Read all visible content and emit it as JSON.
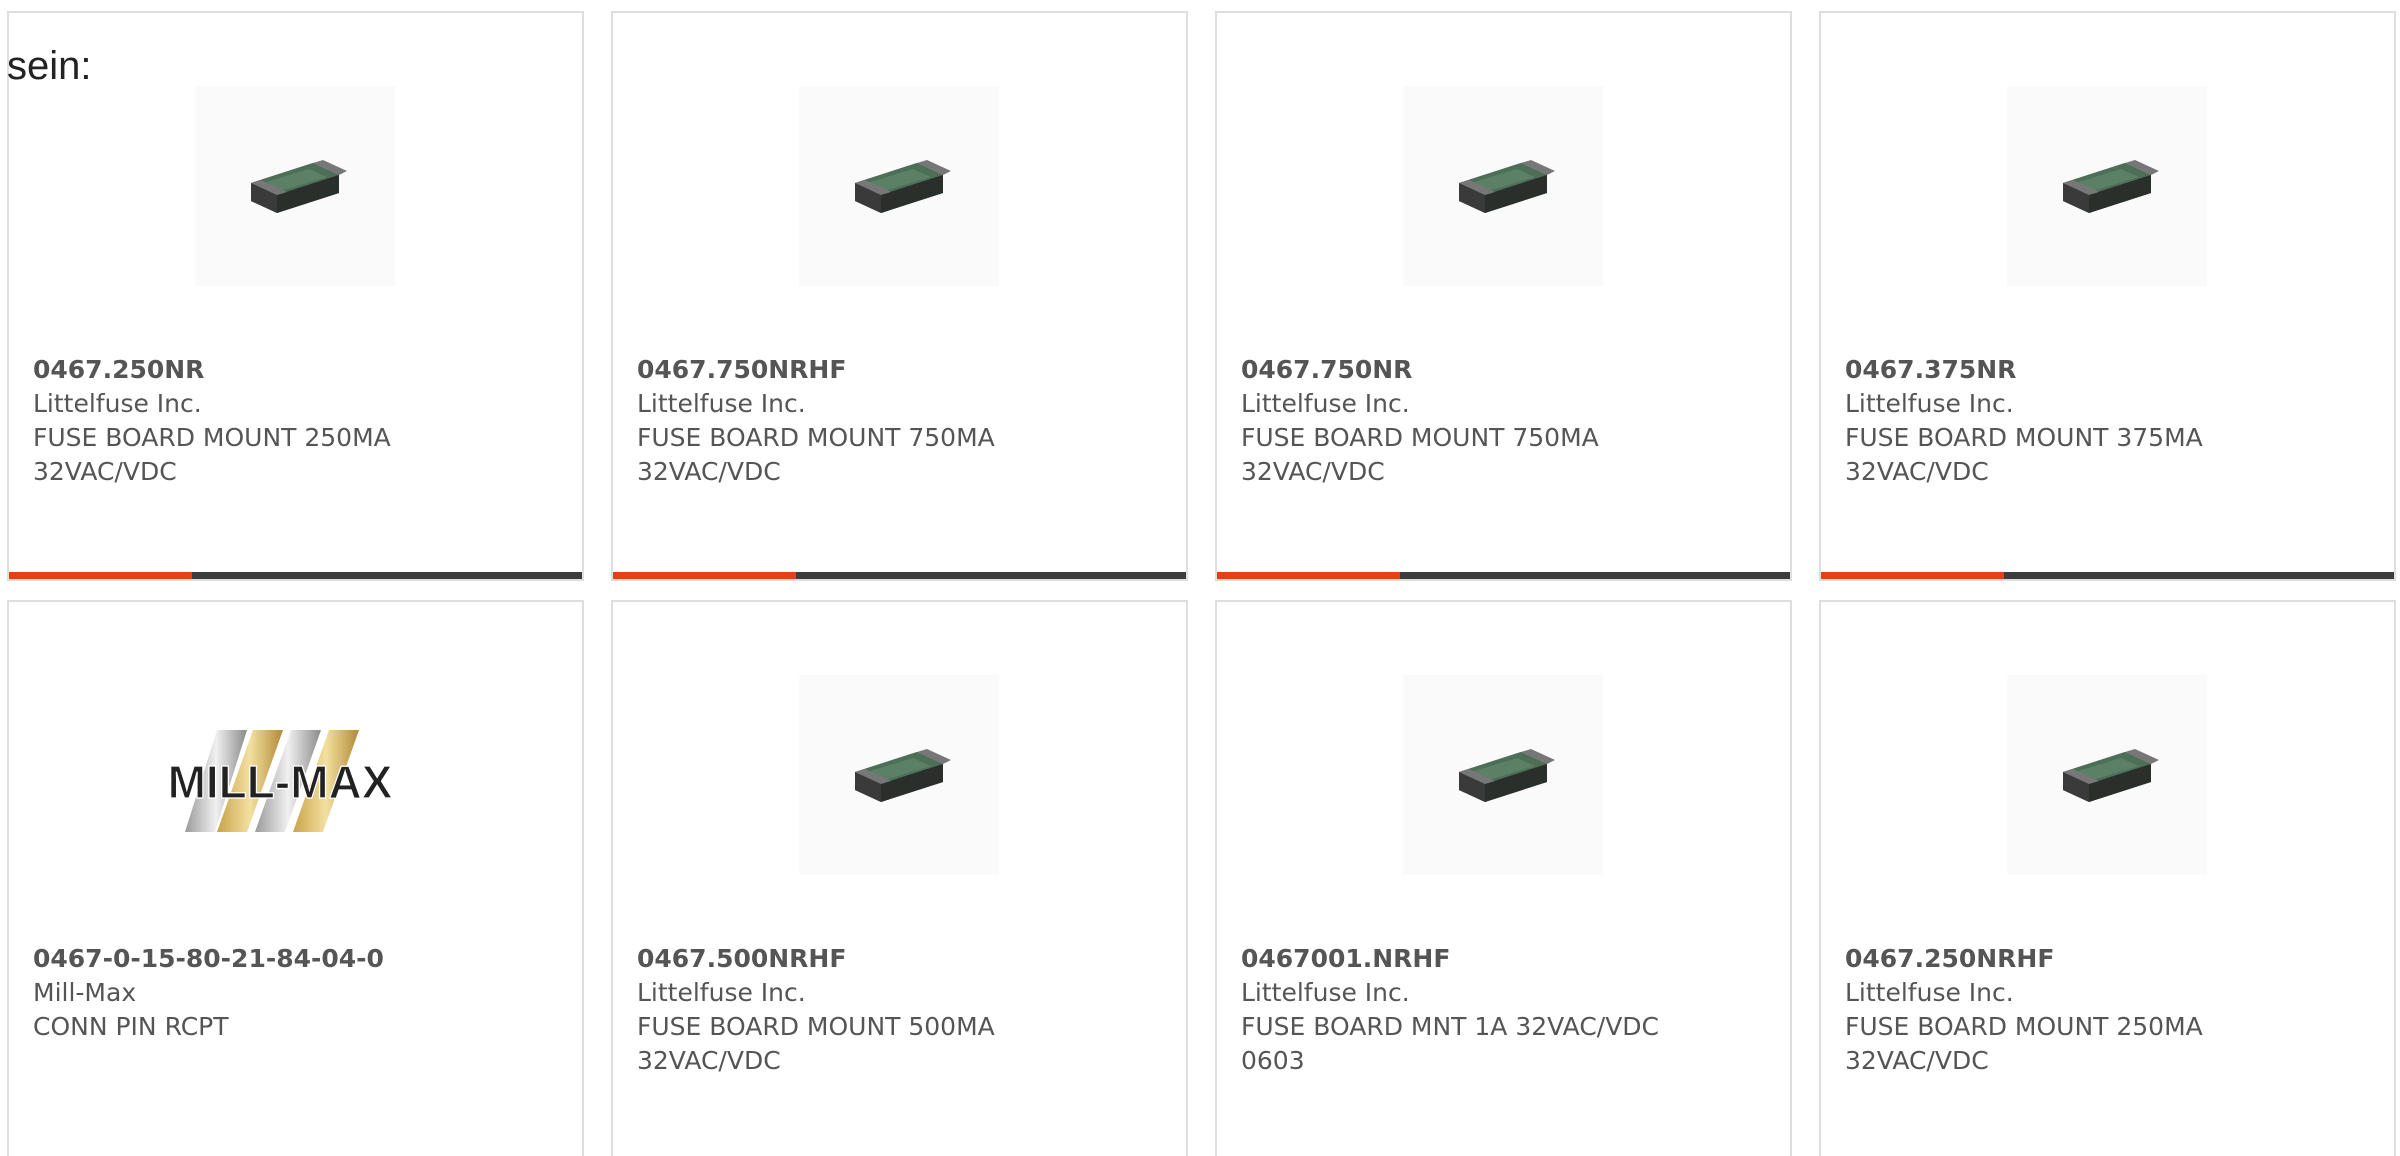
{
  "intro_text": "sein:",
  "accent_color": "#e83e1a",
  "bar_color": "#3c3c3c",
  "products": [
    {
      "part_number": "0467.250NR",
      "manufacturer": "Littelfuse Inc.",
      "description": "FUSE BOARD MOUNT 250MA 32VAC/VDC",
      "image": "fuse-chip-icon",
      "progress_fraction": 0.32
    },
    {
      "part_number": "0467.750NRHF",
      "manufacturer": "Littelfuse Inc.",
      "description": "FUSE BOARD MOUNT 750MA 32VAC/VDC",
      "image": "fuse-chip-icon",
      "progress_fraction": 0.32
    },
    {
      "part_number": "0467.750NR",
      "manufacturer": "Littelfuse Inc.",
      "description": "FUSE BOARD MOUNT 750MA 32VAC/VDC",
      "image": "fuse-chip-icon",
      "progress_fraction": 0.32
    },
    {
      "part_number": "0467.375NR",
      "manufacturer": "Littelfuse Inc.",
      "description": "FUSE BOARD MOUNT 375MA 32VAC/VDC",
      "image": "fuse-chip-icon",
      "progress_fraction": 0.32
    },
    {
      "part_number": "0467-0-15-80-21-84-04-0",
      "manufacturer": "Mill-Max",
      "description": "CONN PIN RCPT",
      "image": "mill-max-logo",
      "logo_text": "MILL-MAX"
    },
    {
      "part_number": "0467.500NRHF",
      "manufacturer": "Littelfuse Inc.",
      "description": "FUSE BOARD MOUNT 500MA 32VAC/VDC",
      "image": "fuse-chip-icon"
    },
    {
      "part_number": "0467001.NRHF",
      "manufacturer": "Littelfuse Inc.",
      "description": "FUSE BOARD MNT 1A 32VAC/VDC 0603",
      "image": "fuse-chip-icon"
    },
    {
      "part_number": "0467.250NRHF",
      "manufacturer": "Littelfuse Inc.",
      "description": "FUSE BOARD MOUNT 250MA 32VAC/VDC",
      "image": "fuse-chip-icon"
    }
  ]
}
